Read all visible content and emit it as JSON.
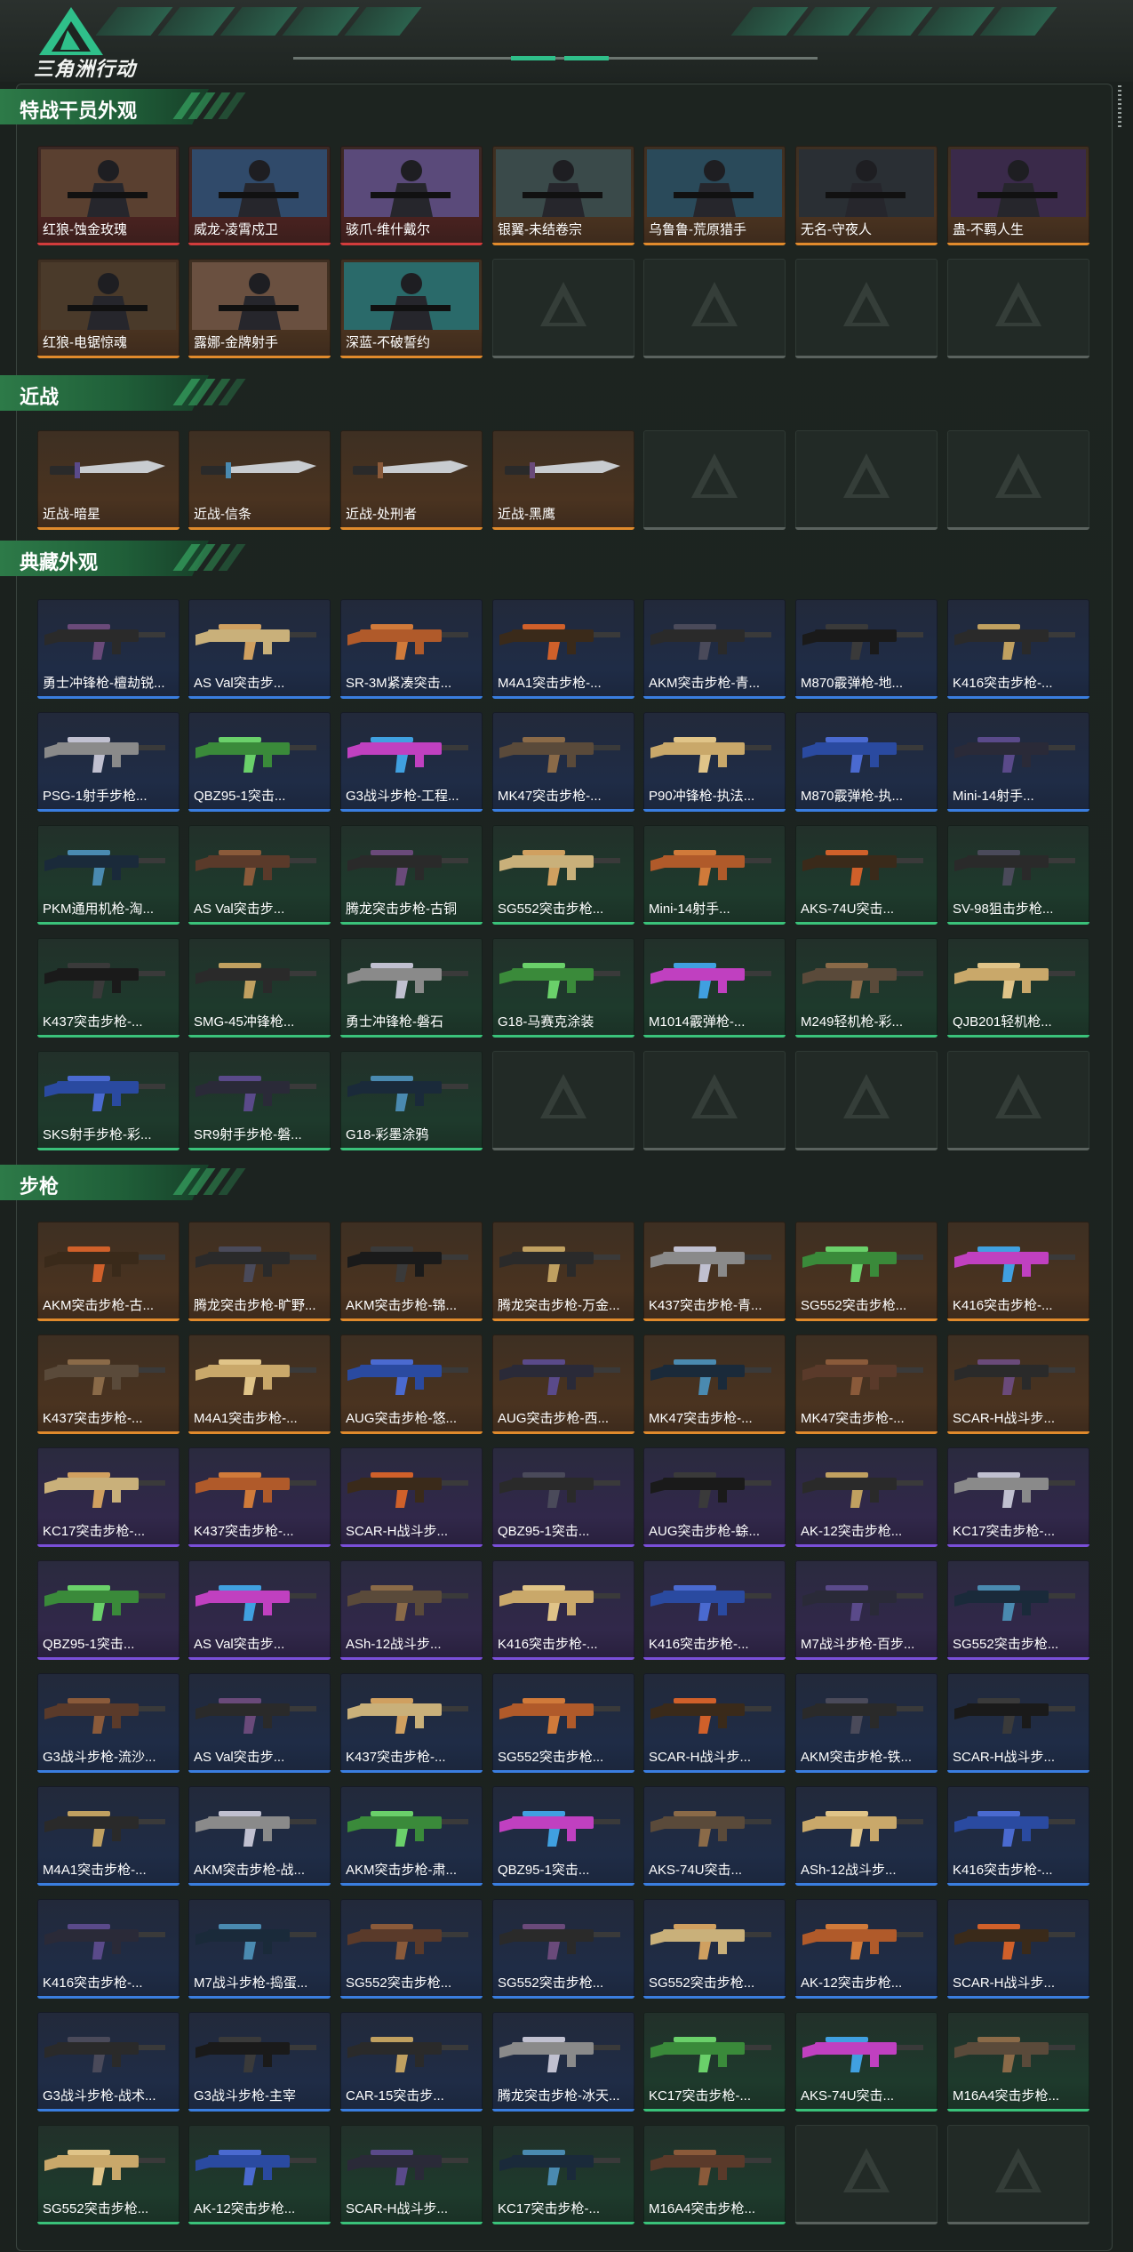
{
  "app": {
    "title": "三角洲行动"
  },
  "colors": {
    "accent": "#2fbf8a",
    "rarity_red": "#d23c3c",
    "rarity_gold": "#e08a2c",
    "rarity_purple": "#7a4fd8",
    "rarity_blue": "#3a7ee0",
    "rarity_green": "#3ac27a"
  },
  "sections": [
    {
      "title": "特战干员外观",
      "kind": "operator",
      "items": [
        {
          "label": "红狼-蚀金玫瑰",
          "rarity": "red"
        },
        {
          "label": "威龙-凌霄戍卫",
          "rarity": "red"
        },
        {
          "label": "骇爪-维什戴尔",
          "rarity": "red"
        },
        {
          "label": "银翼-未结卷宗",
          "rarity": "gold"
        },
        {
          "label": "乌鲁鲁-荒原猎手",
          "rarity": "gold"
        },
        {
          "label": "无名-守夜人",
          "rarity": "gold"
        },
        {
          "label": "蛊-不羁人生",
          "rarity": "gold"
        },
        {
          "label": "红狼-电锯惊魂",
          "rarity": "gold"
        },
        {
          "label": "露娜-金牌射手",
          "rarity": "gold"
        },
        {
          "label": "深蓝-不破誓约",
          "rarity": "gold"
        },
        {
          "label": "",
          "rarity": "empty"
        },
        {
          "label": "",
          "rarity": "empty"
        },
        {
          "label": "",
          "rarity": "empty"
        },
        {
          "label": "",
          "rarity": "empty"
        }
      ]
    },
    {
      "title": "近战",
      "kind": "melee",
      "items": [
        {
          "label": "近战-暗星",
          "rarity": "gold"
        },
        {
          "label": "近战-信条",
          "rarity": "gold"
        },
        {
          "label": "近战-处刑者",
          "rarity": "gold"
        },
        {
          "label": "近战-黑鹰",
          "rarity": "gold"
        },
        {
          "label": "",
          "rarity": "empty"
        },
        {
          "label": "",
          "rarity": "empty"
        },
        {
          "label": "",
          "rarity": "empty"
        }
      ]
    },
    {
      "title": "典藏外观",
      "kind": "gun",
      "items": [
        {
          "label": "勇士冲锋枪-檀劫锐...",
          "rarity": "blue"
        },
        {
          "label": "AS Val突击步...",
          "rarity": "blue"
        },
        {
          "label": "SR-3M紧凑突击...",
          "rarity": "blue"
        },
        {
          "label": "M4A1突击步枪-...",
          "rarity": "blue"
        },
        {
          "label": "AKM突击步枪-青...",
          "rarity": "blue"
        },
        {
          "label": "M870霰弹枪-地...",
          "rarity": "blue"
        },
        {
          "label": "K416突击步枪-...",
          "rarity": "blue"
        },
        {
          "label": "PSG-1射手步枪...",
          "rarity": "blue"
        },
        {
          "label": "QBZ95-1突击...",
          "rarity": "blue"
        },
        {
          "label": "G3战斗步枪-工程...",
          "rarity": "blue"
        },
        {
          "label": "MK47突击步枪-...",
          "rarity": "blue"
        },
        {
          "label": "P90冲锋枪-执法...",
          "rarity": "blue"
        },
        {
          "label": "M870霰弹枪-执...",
          "rarity": "blue"
        },
        {
          "label": "Mini-14射手...",
          "rarity": "blue"
        },
        {
          "label": "PKM通用机枪-淘...",
          "rarity": "green"
        },
        {
          "label": "AS Val突击步...",
          "rarity": "green"
        },
        {
          "label": "腾龙突击步枪-古铜",
          "rarity": "green"
        },
        {
          "label": "SG552突击步枪...",
          "rarity": "green"
        },
        {
          "label": "Mini-14射手...",
          "rarity": "green"
        },
        {
          "label": "AKS-74U突击...",
          "rarity": "green"
        },
        {
          "label": "SV-98狙击步枪...",
          "rarity": "green"
        },
        {
          "label": "K437突击步枪-...",
          "rarity": "green"
        },
        {
          "label": "SMG-45冲锋枪...",
          "rarity": "green"
        },
        {
          "label": "勇士冲锋枪-磐石",
          "rarity": "green"
        },
        {
          "label": "G18-马赛克涂装",
          "rarity": "green"
        },
        {
          "label": "M1014霰弹枪-...",
          "rarity": "green"
        },
        {
          "label": "M249轻机枪-彩...",
          "rarity": "green"
        },
        {
          "label": "QJB201轻机枪...",
          "rarity": "green"
        },
        {
          "label": "SKS射手步枪-彩...",
          "rarity": "green"
        },
        {
          "label": "SR9射手步枪-磐...",
          "rarity": "green"
        },
        {
          "label": "G18-彩墨涂鸦",
          "rarity": "green"
        },
        {
          "label": "",
          "rarity": "empty"
        },
        {
          "label": "",
          "rarity": "empty"
        },
        {
          "label": "",
          "rarity": "empty"
        },
        {
          "label": "",
          "rarity": "empty"
        }
      ]
    },
    {
      "title": "步枪",
      "kind": "gun",
      "items": [
        {
          "label": "AKM突击步枪-古...",
          "rarity": "gold"
        },
        {
          "label": "腾龙突击步枪-旷野...",
          "rarity": "gold"
        },
        {
          "label": "AKM突击步枪-锦...",
          "rarity": "gold"
        },
        {
          "label": "腾龙突击步枪-万金...",
          "rarity": "gold"
        },
        {
          "label": "K437突击步枪-青...",
          "rarity": "gold"
        },
        {
          "label": "SG552突击步枪...",
          "rarity": "gold"
        },
        {
          "label": "K416突击步枪-...",
          "rarity": "gold"
        },
        {
          "label": "K437突击步枪-...",
          "rarity": "gold"
        },
        {
          "label": "M4A1突击步枪-...",
          "rarity": "gold"
        },
        {
          "label": "AUG突击步枪-悠...",
          "rarity": "gold"
        },
        {
          "label": "AUG突击步枪-西...",
          "rarity": "gold"
        },
        {
          "label": "MK47突击步枪-...",
          "rarity": "gold"
        },
        {
          "label": "MK47突击步枪-...",
          "rarity": "gold"
        },
        {
          "label": "SCAR-H战斗步...",
          "rarity": "gold"
        },
        {
          "label": "KC17突击步枪-...",
          "rarity": "purple"
        },
        {
          "label": "K437突击步枪-...",
          "rarity": "purple"
        },
        {
          "label": "SCAR-H战斗步...",
          "rarity": "purple"
        },
        {
          "label": "QBZ95-1突击...",
          "rarity": "purple"
        },
        {
          "label": "AUG突击步枪-蜍...",
          "rarity": "purple"
        },
        {
          "label": "AK-12突击步枪...",
          "rarity": "purple"
        },
        {
          "label": "KC17突击步枪-...",
          "rarity": "purple"
        },
        {
          "label": "QBZ95-1突击...",
          "rarity": "purple"
        },
        {
          "label": "AS Val突击步...",
          "rarity": "purple"
        },
        {
          "label": "ASh-12战斗步...",
          "rarity": "purple"
        },
        {
          "label": "K416突击步枪-...",
          "rarity": "purple"
        },
        {
          "label": "K416突击步枪-...",
          "rarity": "purple"
        },
        {
          "label": "M7战斗步枪-百步...",
          "rarity": "purple"
        },
        {
          "label": "SG552突击步枪...",
          "rarity": "purple"
        },
        {
          "label": "G3战斗步枪-流沙...",
          "rarity": "blue"
        },
        {
          "label": "AS Val突击步...",
          "rarity": "blue"
        },
        {
          "label": "K437突击步枪-...",
          "rarity": "blue"
        },
        {
          "label": "SG552突击步枪...",
          "rarity": "blue"
        },
        {
          "label": "SCAR-H战斗步...",
          "rarity": "blue"
        },
        {
          "label": "AKM突击步枪-铁...",
          "rarity": "blue"
        },
        {
          "label": "SCAR-H战斗步...",
          "rarity": "blue"
        },
        {
          "label": "M4A1突击步枪-...",
          "rarity": "blue"
        },
        {
          "label": "AKM突击步枪-战...",
          "rarity": "blue"
        },
        {
          "label": "AKM突击步枪-肃...",
          "rarity": "blue"
        },
        {
          "label": "QBZ95-1突击...",
          "rarity": "blue"
        },
        {
          "label": "AKS-74U突击...",
          "rarity": "blue"
        },
        {
          "label": "ASh-12战斗步...",
          "rarity": "blue"
        },
        {
          "label": "K416突击步枪-...",
          "rarity": "blue"
        },
        {
          "label": "K416突击步枪-...",
          "rarity": "blue"
        },
        {
          "label": "M7战斗步枪-捣蛋...",
          "rarity": "blue"
        },
        {
          "label": "SG552突击步枪...",
          "rarity": "blue"
        },
        {
          "label": "SG552突击步枪...",
          "rarity": "blue"
        },
        {
          "label": "SG552突击步枪...",
          "rarity": "blue"
        },
        {
          "label": "AK-12突击步枪...",
          "rarity": "blue"
        },
        {
          "label": "SCAR-H战斗步...",
          "rarity": "blue"
        },
        {
          "label": "G3战斗步枪-战术...",
          "rarity": "blue"
        },
        {
          "label": "G3战斗步枪-主宰",
          "rarity": "blue"
        },
        {
          "label": "CAR-15突击步...",
          "rarity": "blue"
        },
        {
          "label": "腾龙突击步枪-冰天...",
          "rarity": "blue"
        },
        {
          "label": "KC17突击步枪-...",
          "rarity": "green"
        },
        {
          "label": "AKS-74U突击...",
          "rarity": "green"
        },
        {
          "label": "M16A4突击步枪...",
          "rarity": "green"
        },
        {
          "label": "SG552突击步枪...",
          "rarity": "green"
        },
        {
          "label": "AK-12突击步枪...",
          "rarity": "green"
        },
        {
          "label": "SCAR-H战斗步...",
          "rarity": "green"
        },
        {
          "label": "KC17突击步枪-...",
          "rarity": "green"
        },
        {
          "label": "M16A4突击步枪...",
          "rarity": "green"
        },
        {
          "label": "",
          "rarity": "empty"
        },
        {
          "label": "",
          "rarity": "empty"
        }
      ]
    }
  ]
}
